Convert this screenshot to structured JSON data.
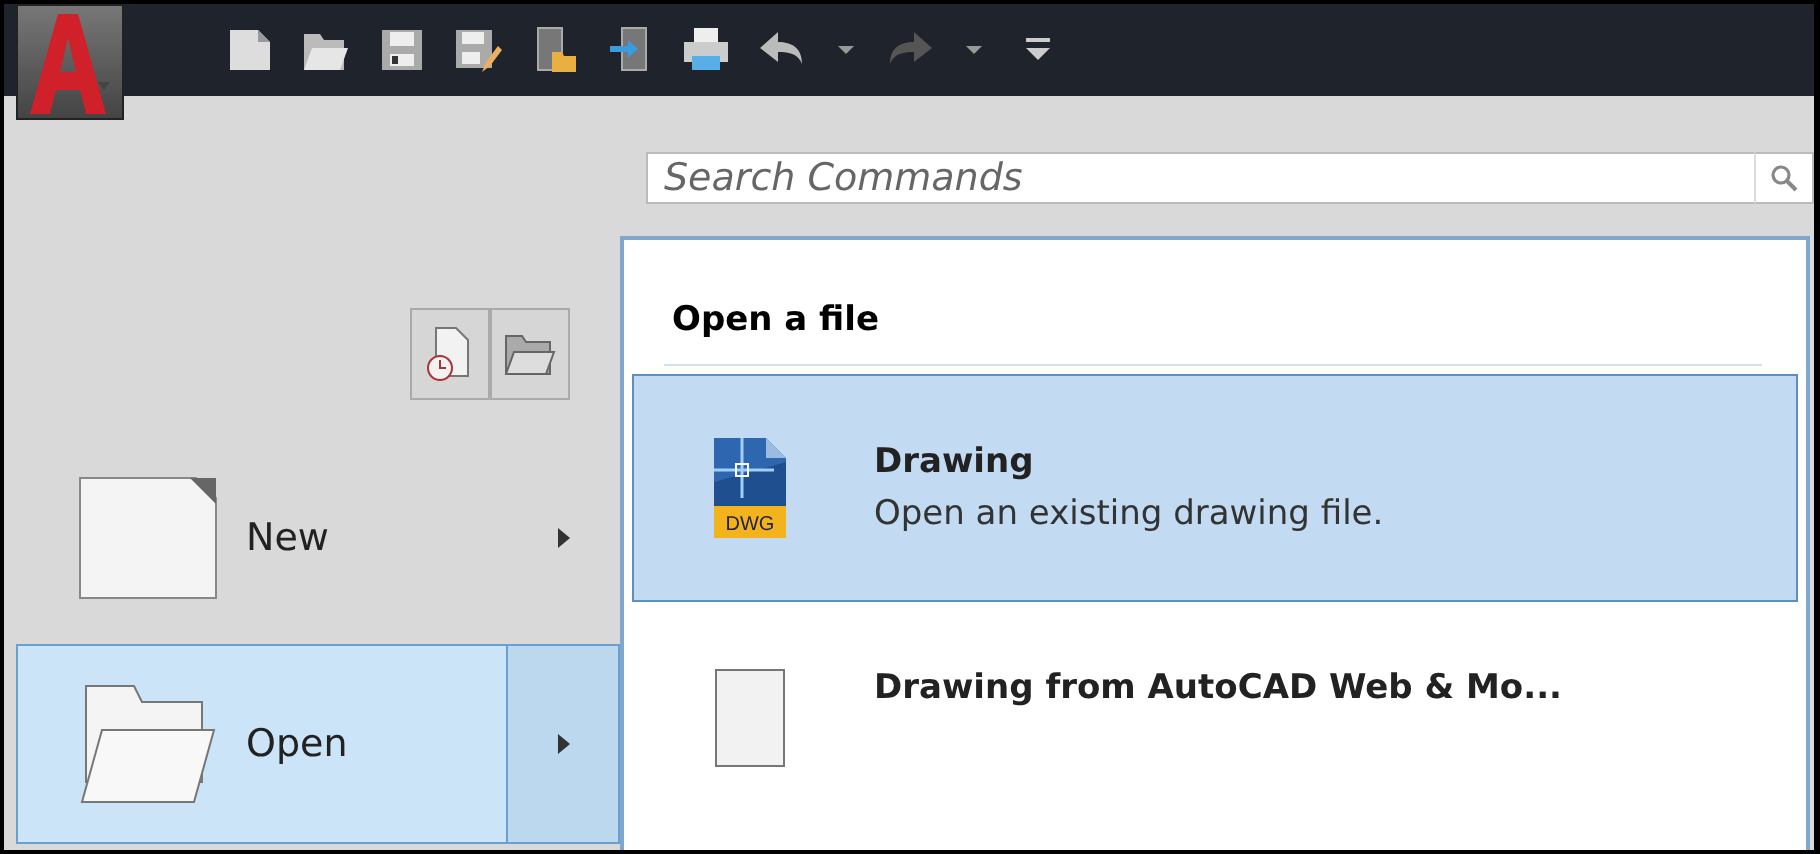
{
  "toolbar": {
    "buttons": [
      {
        "kind": "new"
      },
      {
        "kind": "open"
      },
      {
        "kind": "save"
      },
      {
        "kind": "saveas"
      },
      {
        "kind": "openweb"
      },
      {
        "kind": "saveweb"
      },
      {
        "kind": "print"
      },
      {
        "kind": "undo"
      },
      {
        "kind": "caret"
      },
      {
        "kind": "redo"
      },
      {
        "kind": "caret"
      },
      {
        "kind": "customize"
      }
    ]
  },
  "search": {
    "placeholder": "Search Commands"
  },
  "menu": {
    "items": [
      {
        "label": "New",
        "kind": "new",
        "selected": false
      },
      {
        "label": "Open",
        "kind": "open",
        "selected": true
      }
    ]
  },
  "submenu": {
    "title": "Open a file",
    "items": [
      {
        "title": "Drawing",
        "description": "Open an existing drawing file.",
        "kind": "dwg",
        "badge": "DWG",
        "selected": true
      },
      {
        "title": "Drawing from AutoCAD Web & Mo...",
        "kind": "blank",
        "selected": false
      }
    ]
  }
}
